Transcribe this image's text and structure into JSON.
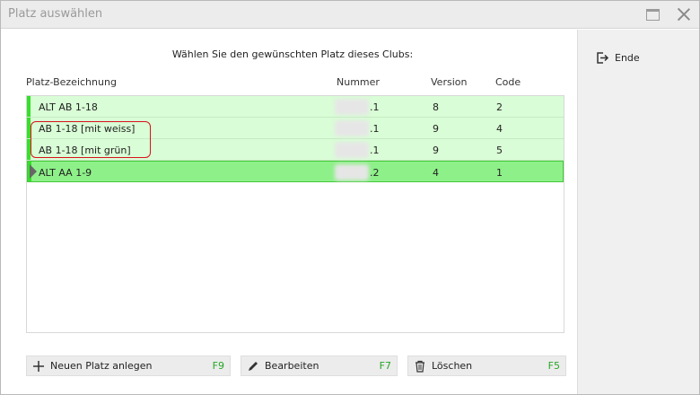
{
  "window": {
    "title": "Platz auswählen"
  },
  "heading": "Wählen Sie den gewünschten Platz dieses Clubs:",
  "columns": {
    "name": "Platz-Bezeichnung",
    "number": "Nummer",
    "version": "Version",
    "code": "Code"
  },
  "rows": [
    {
      "name": "ALT AB 1-18",
      "number": ".1",
      "version": "8",
      "code": "2"
    },
    {
      "name": "AB 1-18 [mit weiss]",
      "number": ".1",
      "version": "9",
      "code": "4"
    },
    {
      "name": "AB 1-18 [mit grün]",
      "number": ".1",
      "version": "9",
      "code": "5"
    },
    {
      "name": "ALT AA 1-9",
      "number": ".2",
      "version": "4",
      "code": "1"
    }
  ],
  "sidebar": {
    "end_label": "Ende"
  },
  "buttons": {
    "new": {
      "label": "Neuen Platz anlegen",
      "key": "F9"
    },
    "edit": {
      "label": "Bearbeiten",
      "key": "F7"
    },
    "delete": {
      "label": "Löschen",
      "key": "F5"
    }
  },
  "colors": {
    "row_bg": "#d9fdd6",
    "selected_bg": "#8ef089",
    "marker": "#35e02a",
    "highlight": "#d9121a",
    "key_text": "#26a626"
  }
}
